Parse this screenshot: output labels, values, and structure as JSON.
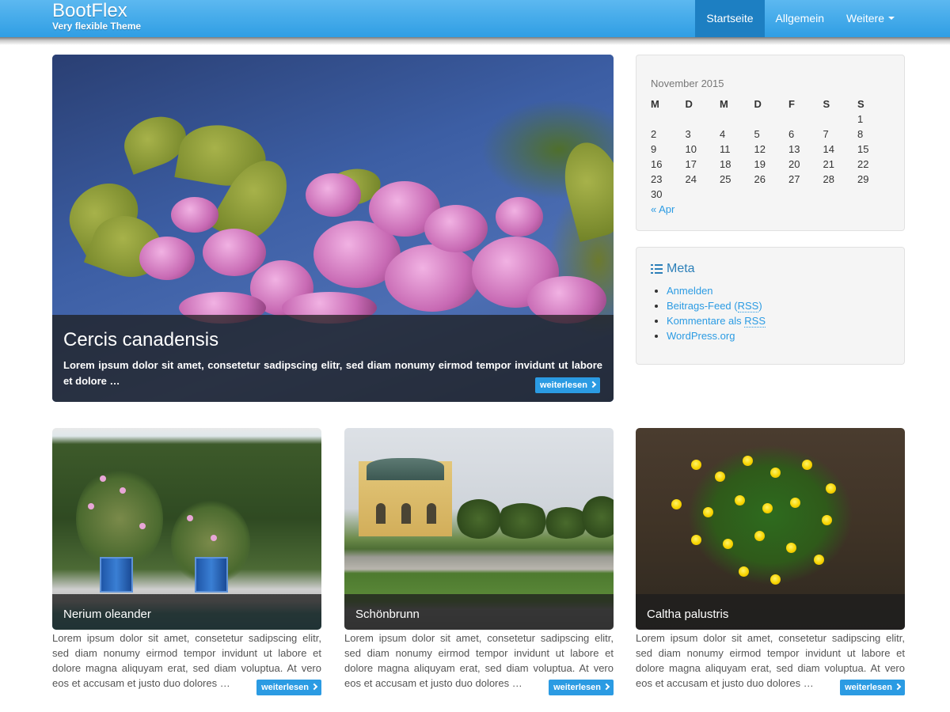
{
  "header": {
    "brand_title": "BootFlex",
    "brand_subtitle": "Very flexible Theme",
    "nav": [
      {
        "label": "Startseite",
        "active": true
      },
      {
        "label": "Allgemein",
        "active": false
      },
      {
        "label": "Weitere",
        "active": false,
        "dropdown": true
      }
    ],
    "color_bar": "#2f9ee4",
    "color_active": "#1d7fc2"
  },
  "hero": {
    "title": "Cercis canadensis",
    "text": "Lorem ipsum dolor sit amet, consetetur sadipscing elitr, sed diam nonumy eirmod tempor invidunt ut labore et dolore …",
    "more_label": "weiterlesen"
  },
  "calendar": {
    "caption": "November 2015",
    "weekdays": [
      "M",
      "D",
      "M",
      "D",
      "F",
      "S",
      "S"
    ],
    "weeks": [
      [
        "",
        "",
        "",
        "",
        "",
        "",
        "1"
      ],
      [
        "2",
        "3",
        "4",
        "5",
        "6",
        "7",
        "8"
      ],
      [
        "9",
        "10",
        "11",
        "12",
        "13",
        "14",
        "15"
      ],
      [
        "16",
        "17",
        "18",
        "19",
        "20",
        "21",
        "22"
      ],
      [
        "23",
        "24",
        "25",
        "26",
        "27",
        "28",
        "29"
      ],
      [
        "30",
        "",
        "",
        "",
        "",
        "",
        ""
      ]
    ],
    "prev_label": "« Apr"
  },
  "meta": {
    "title": "Meta",
    "icon": "list-icon",
    "items": [
      {
        "label": "Anmelden"
      },
      {
        "prefix": "Beitrags-Feed (",
        "abbr": "RSS",
        "suffix": ")"
      },
      {
        "prefix": "Kommentare als ",
        "abbr": "RSS",
        "suffix": ""
      },
      {
        "label": "WordPress.org"
      }
    ]
  },
  "cards": [
    {
      "title": "Nerium oleander",
      "text": "Lorem ipsum dolor sit amet, consetetur sadipscing elitr, sed diam nonumy eirmod tempor invidunt ut labore et dolore magna aliquyam erat, sed diam voluptua. At vero eos et accusam et justo duo dolores …",
      "more_label": "weiterlesen"
    },
    {
      "title": "Schönbrunn",
      "text": "Lorem ipsum dolor sit amet, consetetur sadipscing elitr, sed diam nonumy eirmod tempor invidunt ut labore et dolore magna aliquyam erat, sed diam voluptua. At vero eos et accusam et justo duo dolores …",
      "more_label": "weiterlesen"
    },
    {
      "title": "Caltha palustris",
      "text": "Lorem ipsum dolor sit amet, consetetur sadipscing elitr, sed diam nonumy eirmod tempor invidunt ut labore et dolore magna aliquyam erat, sed diam voluptua. At vero eos et accusam et justo duo dolores …",
      "more_label": "weiterlesen"
    }
  ]
}
